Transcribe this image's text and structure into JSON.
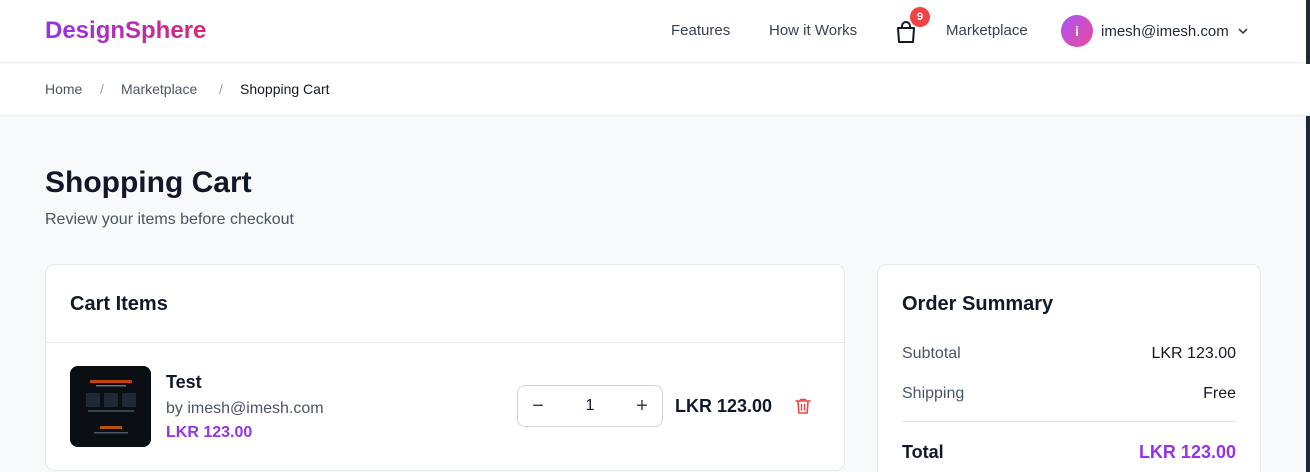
{
  "header": {
    "logo": "DesignSphere",
    "nav": {
      "features": "Features",
      "how_it_works": "How it Works",
      "marketplace": "Marketplace"
    },
    "cart_count": "9",
    "user": {
      "initial": "i",
      "email": "imesh@imesh.com"
    }
  },
  "breadcrumb": {
    "home": "Home",
    "sep": "/",
    "marketplace": "Marketplace",
    "current": "Shopping Cart"
  },
  "page": {
    "title": "Shopping Cart",
    "subtitle": "Review your items before checkout"
  },
  "cart": {
    "title": "Cart Items",
    "items": [
      {
        "name": "Test",
        "by": "by imesh@imesh.com",
        "price": "LKR 123.00",
        "quantity": "1",
        "line_total": "LKR 123.00",
        "decrement": "−",
        "increment": "+"
      }
    ]
  },
  "summary": {
    "title": "Order Summary",
    "subtotal_label": "Subtotal",
    "subtotal_value": "LKR 123.00",
    "shipping_label": "Shipping",
    "shipping_value": "Free",
    "total_label": "Total",
    "total_value": "LKR 123.00"
  },
  "colors": {
    "accent": "#9333ea",
    "badge": "#ef4444",
    "danger": "#ef4444"
  },
  "icons": [
    "shopping-bag-icon",
    "chevron-down-icon",
    "trash-icon",
    "minus-icon",
    "plus-icon"
  ]
}
